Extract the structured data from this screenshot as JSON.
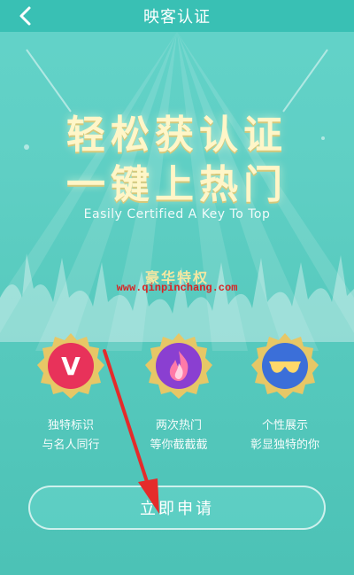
{
  "header": {
    "title": "映客认证",
    "back_icon": "chevron-left-icon"
  },
  "hero": {
    "line1": "轻松获认证",
    "line2": "一键上热门",
    "subtitle": "Easily Certified  A Key To Top"
  },
  "privileges": {
    "title": "豪华特权",
    "watermark": "www.qinpinchang.com",
    "items": [
      {
        "icon": "v-badge-icon",
        "line1": "独特标识",
        "line2": "与名人同行",
        "color": "#e8325a"
      },
      {
        "icon": "flame-badge-icon",
        "line1": "两次热门",
        "line2": "等你截截截",
        "color": "#8a3fd1"
      },
      {
        "icon": "sunglasses-badge-icon",
        "line1": "个性展示",
        "line2": "彰显独特的你",
        "color": "#3b6fd9"
      }
    ]
  },
  "apply_button": {
    "label": "立即申请"
  },
  "colors": {
    "header_bg": "#39c0b4",
    "headline": "#fff6c8",
    "badge_gold": "#e7c766",
    "arrow": "#e52b2b"
  }
}
